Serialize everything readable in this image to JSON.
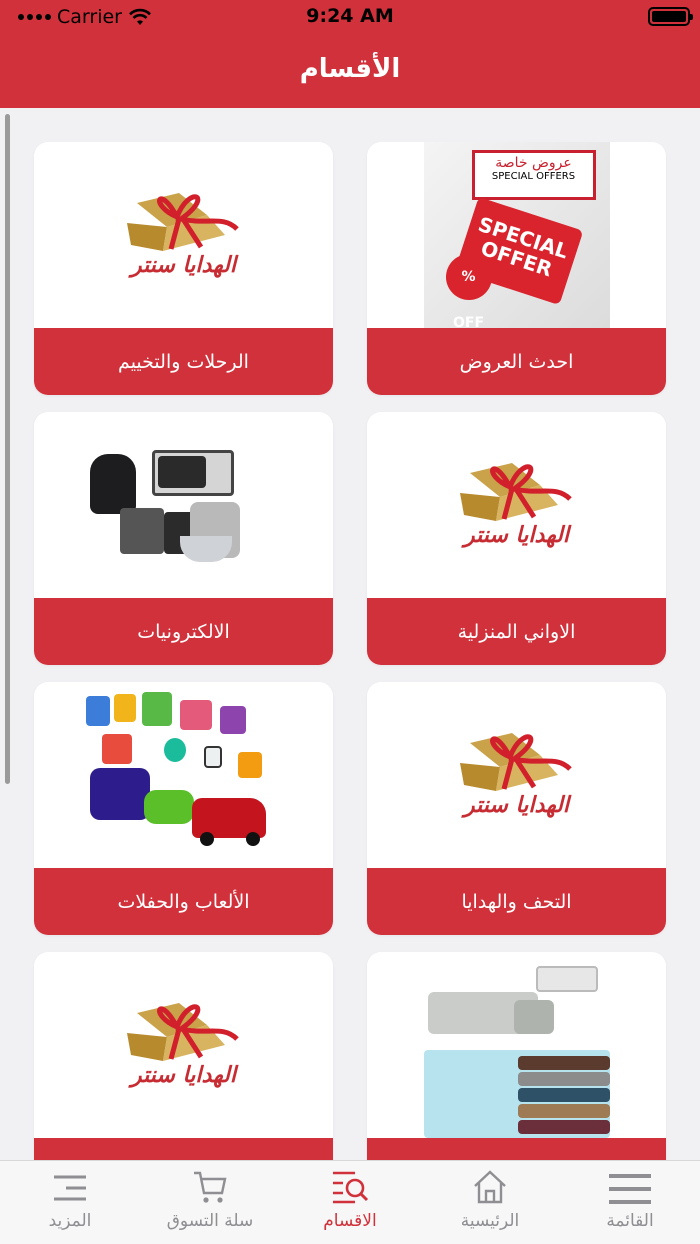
{
  "status_bar": {
    "carrier": "Carrier",
    "time": "9:24 AM"
  },
  "header": {
    "title": "الأقسام"
  },
  "brand": {
    "logo_text": "الهدايا سنتر"
  },
  "offer_image": {
    "arabic": "عروض خاصة",
    "english": "SPECIAL OFFERS",
    "tag": "SPECIAL OFFER",
    "badge": "% OFF"
  },
  "categories": [
    {
      "label": "احدث العروض",
      "image": "special-offers"
    },
    {
      "label": "الرحلات والتخييم",
      "image": "brand-logo"
    },
    {
      "label": "الاواني المنزلية",
      "image": "brand-logo"
    },
    {
      "label": "الالكترونيات",
      "image": "appliances"
    },
    {
      "label": "التحف والهدايا",
      "image": "brand-logo"
    },
    {
      "label": "الألعاب والحفلات",
      "image": "toys"
    },
    {
      "label": "",
      "image": "furniture"
    },
    {
      "label": "",
      "image": "brand-logo"
    }
  ],
  "tab_bar": {
    "items": [
      {
        "label": "القائمة",
        "icon": "menu-icon",
        "active": false
      },
      {
        "label": "الرئيسية",
        "icon": "home-icon",
        "active": false
      },
      {
        "label": "الاقسام",
        "icon": "category-search-icon",
        "active": true
      },
      {
        "label": "سلة التسوق",
        "icon": "cart-icon",
        "active": false
      },
      {
        "label": "المزيد",
        "icon": "more-icon",
        "active": false
      }
    ]
  },
  "colors": {
    "brand_red": "#d0313b",
    "inactive_gray": "#8e8e93",
    "background": "#f1f1f4"
  }
}
